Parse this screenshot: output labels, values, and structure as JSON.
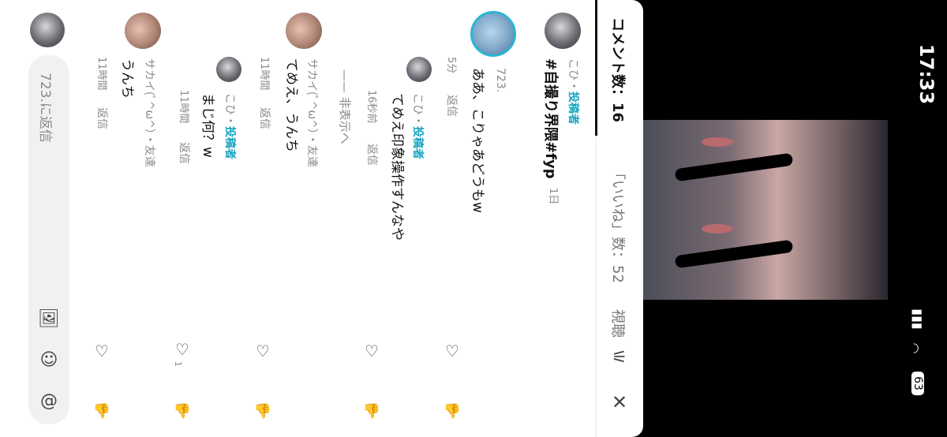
{
  "status_bar": {
    "time": "17:33",
    "battery": "63"
  },
  "header": {
    "tab_comments": "コメント数：16",
    "tab_likes": "「いいね」数：52",
    "tab_views": "視聴",
    "filter_icon": "sliders-icon",
    "close_icon": "close-icon"
  },
  "comments": [
    {
      "author": "こひ・",
      "author_badge": "投稿者",
      "text": "#自撮り界隈#fyp",
      "time": "1日",
      "replies": [
        {
          "author": "723.",
          "text": "ああ、こりゃあどうもw",
          "time": "5分",
          "reply_label": "返信"
        },
        {
          "author": "こひ・",
          "author_badge": "投稿者",
          "text": "てめえ印象操作すんなや",
          "time": "16秒前",
          "reply_label": "返信"
        }
      ],
      "hide_label": "非表示へ"
    },
    {
      "author": "サカイ(ﾟ^ω^）・友達",
      "text": "てめえ、うんち",
      "time": "11時間",
      "reply_label": "返信",
      "replies": [
        {
          "author": "こひ・",
          "author_badge": "投稿者",
          "text": "まじ何？w",
          "time": "11時間",
          "reply_label": "返信",
          "likes": "1"
        }
      ]
    },
    {
      "author": "サカイ(ﾟ^ω^）・友達",
      "text": "うんち",
      "time": "11時間",
      "reply_label": "返信"
    }
  ],
  "input": {
    "placeholder": "723.に返信"
  }
}
